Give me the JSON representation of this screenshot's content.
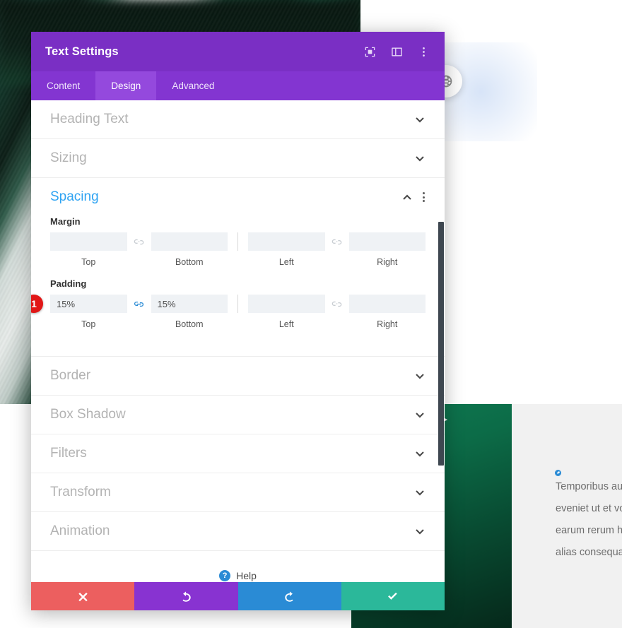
{
  "modal": {
    "title": "Text Settings",
    "header_icons": [
      {
        "name": "focus-frame-icon",
        "label": "Focus"
      },
      {
        "name": "layout-split-icon",
        "label": "Layout"
      },
      {
        "name": "kebab-menu-icon",
        "label": "More options"
      }
    ],
    "tabs": [
      {
        "label": "Content",
        "active": false
      },
      {
        "label": "Design",
        "active": true
      },
      {
        "label": "Advanced",
        "active": false
      }
    ],
    "sections": [
      {
        "title": "Heading Text",
        "open": false
      },
      {
        "title": "Sizing",
        "open": false
      },
      {
        "title": "Spacing",
        "open": true
      },
      {
        "title": "Border",
        "open": false
      },
      {
        "title": "Box Shadow",
        "open": false
      },
      {
        "title": "Filters",
        "open": false
      },
      {
        "title": "Transform",
        "open": false
      },
      {
        "title": "Animation",
        "open": false
      }
    ],
    "spacing": {
      "margin": {
        "label": "Margin",
        "top": {
          "value": "",
          "placeholder": "",
          "caption": "Top"
        },
        "bottom": {
          "value": "",
          "placeholder": "",
          "caption": "Bottom"
        },
        "left": {
          "value": "",
          "placeholder": "",
          "caption": "Left"
        },
        "right": {
          "value": "",
          "placeholder": "",
          "caption": "Right"
        },
        "link_top_bottom": "unlinked",
        "link_left_right": "unlinked"
      },
      "padding": {
        "label": "Padding",
        "top": {
          "value": "15%",
          "placeholder": "",
          "caption": "Top"
        },
        "bottom": {
          "value": "15%",
          "placeholder": "",
          "caption": "Bottom"
        },
        "left": {
          "value": "",
          "placeholder": "",
          "caption": "Left"
        },
        "right": {
          "value": "",
          "placeholder": "",
          "caption": "Right"
        },
        "link_top_bottom": "linked",
        "link_left_right": "unlinked"
      },
      "step_badge": "1"
    },
    "help": {
      "label": "Help",
      "icon_glyph": "?"
    },
    "footer": [
      {
        "name": "close-button",
        "glyph": "✖",
        "color": "#ec5f5f"
      },
      {
        "name": "undo-button",
        "glyph": "↺",
        "color": "#8833d1"
      },
      {
        "name": "redo-button",
        "glyph": "↻",
        "color": "#2a8bd5"
      },
      {
        "name": "save-button",
        "glyph": "✔",
        "color": "#2bb89a"
      }
    ]
  },
  "background": {
    "text_lines": [
      "Temporibus au",
      "eveniet ut et vo",
      "earum rerum h",
      "alias consequa"
    ]
  },
  "colors": {
    "header_purple": "#7a2fc4",
    "tabs_purple": "#8335d1",
    "tab_active_purple": "#9449dd",
    "accent_blue": "#2ea3f2",
    "link_active_blue": "#2a8bd5",
    "badge_red": "#e11717",
    "input_bg": "#eff2f5"
  }
}
